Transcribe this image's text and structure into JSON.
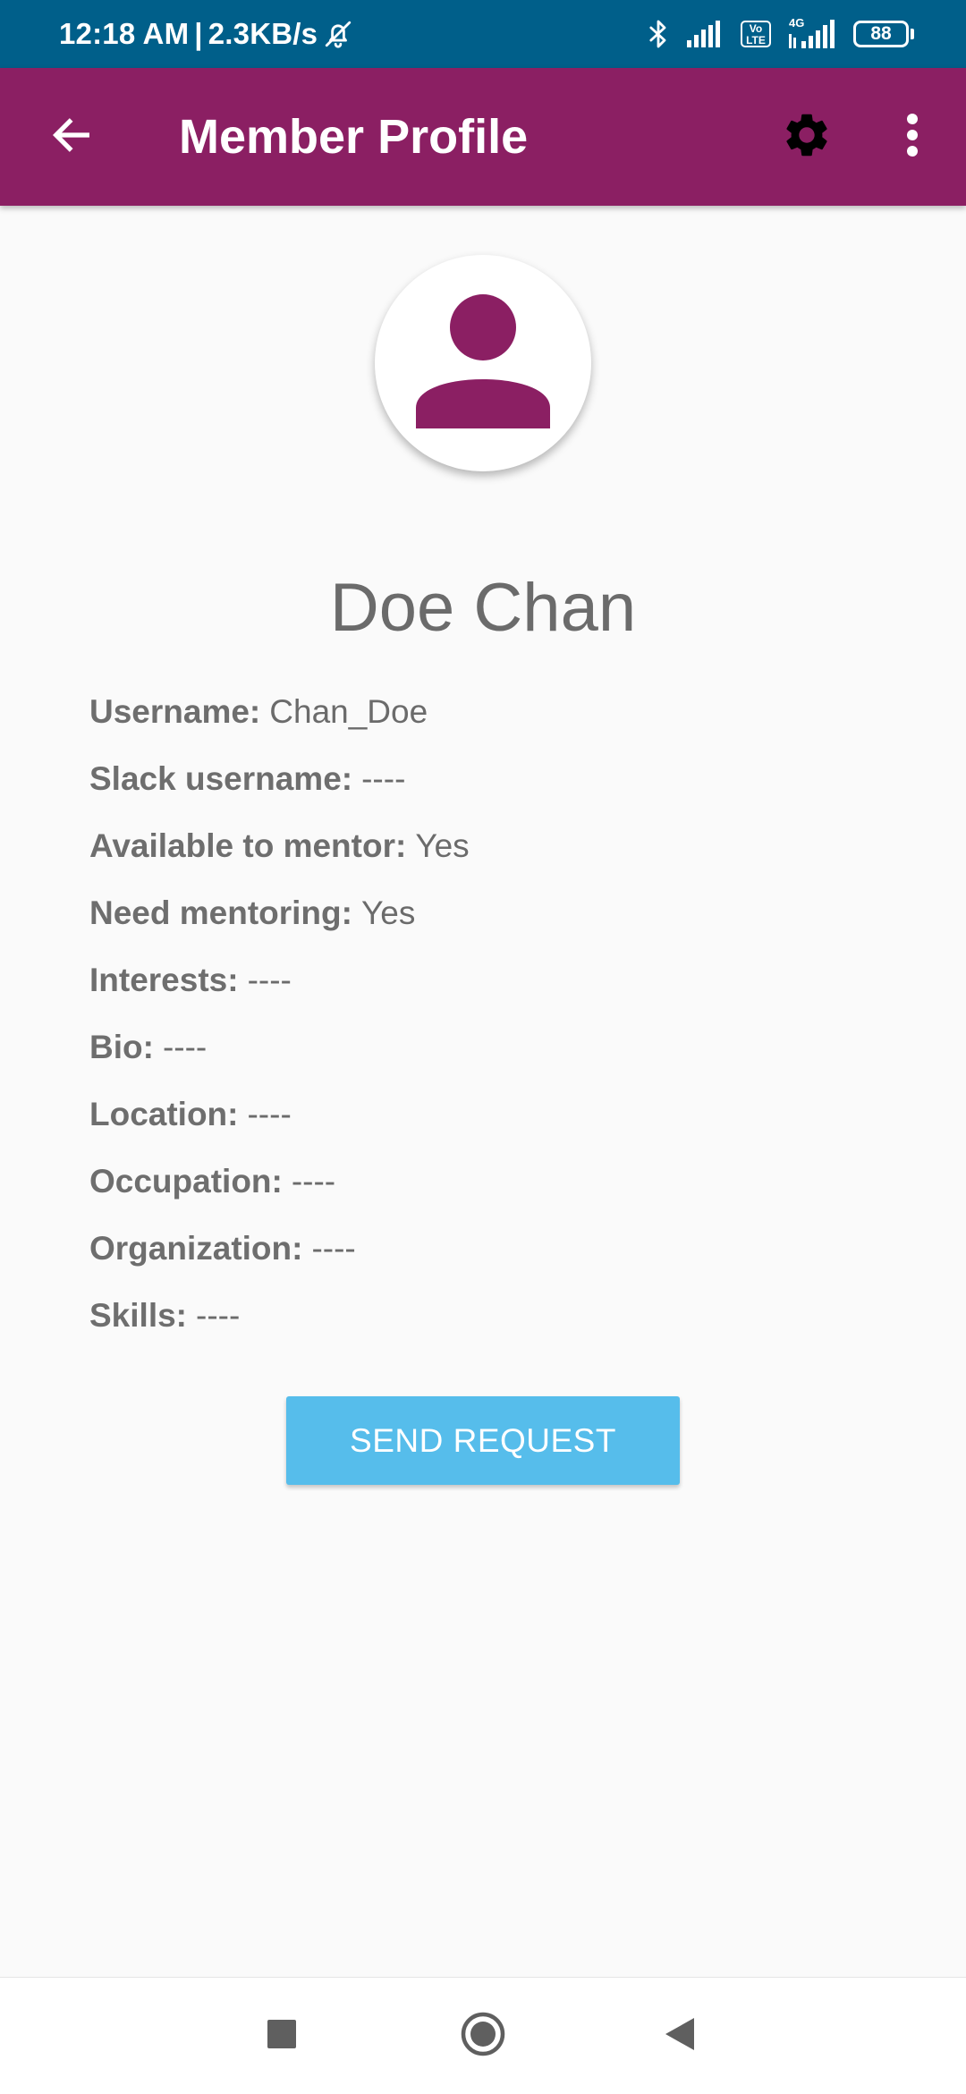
{
  "status_bar": {
    "time": "12:18 AM",
    "separator": "|",
    "network_speed": "2.3KB/s",
    "icons": [
      "alarm-off-icon",
      "bluetooth-icon",
      "signal-icon",
      "volte-icon",
      "signal-4g-icon",
      "battery-icon"
    ],
    "volte_top": "Vo",
    "volte_bottom": "LTE",
    "network_type": "4G",
    "battery_level": "88"
  },
  "app_bar": {
    "title": "Member Profile",
    "color": "#8b1f63",
    "icons": [
      "back-arrow-icon",
      "gear-icon",
      "more-vert-icon"
    ]
  },
  "profile": {
    "avatar_icon": "person-icon",
    "name": "Doe Chan",
    "fields": [
      {
        "label": "Username:",
        "value": "Chan_Doe"
      },
      {
        "label": "Slack username:",
        "value": "----"
      },
      {
        "label": "Available to mentor:",
        "value": "Yes"
      },
      {
        "label": "Need mentoring:",
        "value": "Yes"
      },
      {
        "label": "Interests:",
        "value": "----"
      },
      {
        "label": "Bio:",
        "value": "----"
      },
      {
        "label": "Location:",
        "value": "----"
      },
      {
        "label": "Occupation:",
        "value": "----"
      },
      {
        "label": "Organization:",
        "value": "----"
      },
      {
        "label": "Skills:",
        "value": "----"
      }
    ]
  },
  "actions": {
    "send_request_label": "SEND REQUEST",
    "button_color": "#56bdeb"
  },
  "nav_bar": {
    "icons": [
      "recents-square-icon",
      "home-circle-icon",
      "back-triangle-icon"
    ]
  }
}
